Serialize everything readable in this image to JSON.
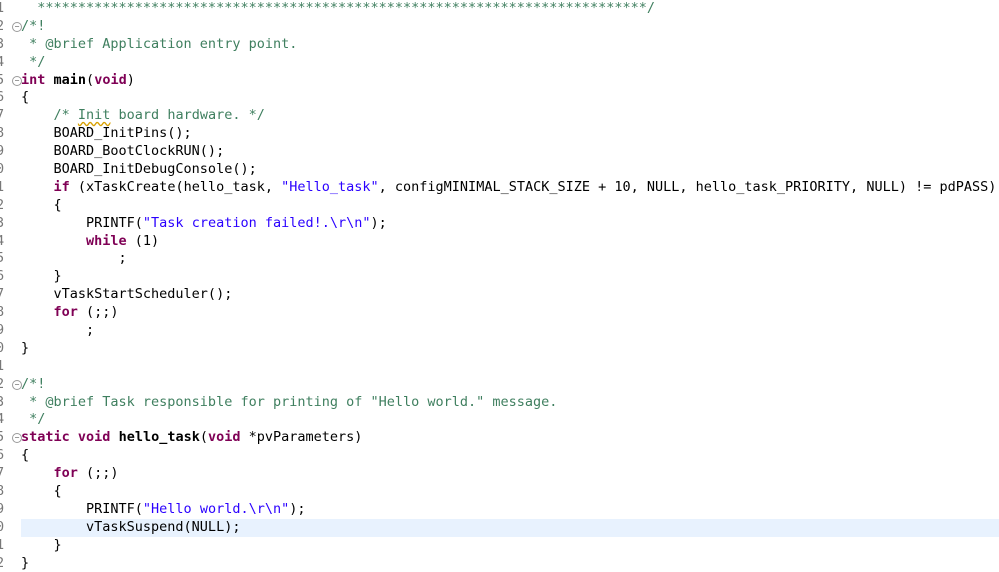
{
  "editor": {
    "lines": [
      {
        "num": "1",
        "fold": false,
        "tokens": [
          {
            "t": "comment",
            "v": "  ***************************************************************************/"
          }
        ]
      },
      {
        "num": "2",
        "fold": true,
        "tokens": [
          {
            "t": "comment",
            "v": "/*!"
          }
        ]
      },
      {
        "num": "3",
        "fold": false,
        "tokens": [
          {
            "t": "comment",
            "v": " * @brief Application entry point."
          }
        ]
      },
      {
        "num": "4",
        "fold": false,
        "tokens": [
          {
            "t": "comment",
            "v": " */"
          }
        ]
      },
      {
        "num": "5",
        "fold": true,
        "tokens": [
          {
            "t": "kw",
            "v": "int"
          },
          {
            "t": "id",
            "v": " "
          },
          {
            "t": "fn",
            "v": "main"
          },
          {
            "t": "id",
            "v": "("
          },
          {
            "t": "kw",
            "v": "void"
          },
          {
            "t": "id",
            "v": ")"
          }
        ]
      },
      {
        "num": "6",
        "fold": false,
        "tokens": [
          {
            "t": "id",
            "v": "{"
          }
        ]
      },
      {
        "num": "7",
        "fold": false,
        "tokens": [
          {
            "t": "comment",
            "v": "    /* "
          },
          {
            "t": "comment-spell",
            "v": "Init"
          },
          {
            "t": "comment",
            "v": " board hardware. */"
          }
        ]
      },
      {
        "num": "8",
        "fold": false,
        "tokens": [
          {
            "t": "id",
            "v": "    BOARD_InitPins();"
          }
        ]
      },
      {
        "num": "9",
        "fold": false,
        "tokens": [
          {
            "t": "id",
            "v": "    BOARD_BootClockRUN();"
          }
        ]
      },
      {
        "num": "0",
        "fold": false,
        "tokens": [
          {
            "t": "id",
            "v": "    BOARD_InitDebugConsole();"
          }
        ]
      },
      {
        "num": "1",
        "fold": false,
        "tokens": [
          {
            "t": "id",
            "v": "    "
          },
          {
            "t": "kw",
            "v": "if"
          },
          {
            "t": "id",
            "v": " (xTaskCreate(hello_task, "
          },
          {
            "t": "str",
            "v": "\"Hello_task\""
          },
          {
            "t": "id",
            "v": ", configMINIMAL_STACK_SIZE + 10, NULL, hello_task_PRIORITY, NULL) != pdPASS)"
          }
        ]
      },
      {
        "num": "2",
        "fold": false,
        "tokens": [
          {
            "t": "id",
            "v": "    {"
          }
        ]
      },
      {
        "num": "3",
        "fold": false,
        "tokens": [
          {
            "t": "id",
            "v": "        PRINTF("
          },
          {
            "t": "str",
            "v": "\"Task creation failed!.\\r\\n\""
          },
          {
            "t": "id",
            "v": ");"
          }
        ]
      },
      {
        "num": "4",
        "fold": false,
        "tokens": [
          {
            "t": "id",
            "v": "        "
          },
          {
            "t": "kw",
            "v": "while"
          },
          {
            "t": "id",
            "v": " (1)"
          }
        ]
      },
      {
        "num": "5",
        "fold": false,
        "tokens": [
          {
            "t": "id",
            "v": "            ;"
          }
        ]
      },
      {
        "num": "6",
        "fold": false,
        "tokens": [
          {
            "t": "id",
            "v": "    }"
          }
        ]
      },
      {
        "num": "7",
        "fold": false,
        "tokens": [
          {
            "t": "id",
            "v": "    vTaskStartScheduler();"
          }
        ]
      },
      {
        "num": "8",
        "fold": false,
        "tokens": [
          {
            "t": "id",
            "v": "    "
          },
          {
            "t": "kw",
            "v": "for"
          },
          {
            "t": "id",
            "v": " (;;)"
          }
        ]
      },
      {
        "num": "9",
        "fold": false,
        "tokens": [
          {
            "t": "id",
            "v": "        ;"
          }
        ]
      },
      {
        "num": "0",
        "fold": false,
        "tokens": [
          {
            "t": "id",
            "v": "}"
          }
        ]
      },
      {
        "num": "1",
        "fold": false,
        "tokens": []
      },
      {
        "num": "2",
        "fold": true,
        "tokens": [
          {
            "t": "comment",
            "v": "/*!"
          }
        ]
      },
      {
        "num": "3",
        "fold": false,
        "tokens": [
          {
            "t": "comment",
            "v": " * @brief Task responsible for printing of \"Hello world.\" message."
          }
        ]
      },
      {
        "num": "4",
        "fold": false,
        "tokens": [
          {
            "t": "comment",
            "v": " */"
          }
        ]
      },
      {
        "num": "5",
        "fold": true,
        "tokens": [
          {
            "t": "kw",
            "v": "static"
          },
          {
            "t": "id",
            "v": " "
          },
          {
            "t": "kw",
            "v": "void"
          },
          {
            "t": "id",
            "v": " "
          },
          {
            "t": "fn",
            "v": "hello_task"
          },
          {
            "t": "id",
            "v": "("
          },
          {
            "t": "kw",
            "v": "void"
          },
          {
            "t": "id",
            "v": " *pvParameters)"
          }
        ]
      },
      {
        "num": "6",
        "fold": false,
        "tokens": [
          {
            "t": "id",
            "v": "{"
          }
        ]
      },
      {
        "num": "7",
        "fold": false,
        "tokens": [
          {
            "t": "id",
            "v": "    "
          },
          {
            "t": "kw",
            "v": "for"
          },
          {
            "t": "id",
            "v": " (;;)"
          }
        ]
      },
      {
        "num": "8",
        "fold": false,
        "tokens": [
          {
            "t": "id",
            "v": "    {"
          }
        ]
      },
      {
        "num": "9",
        "fold": false,
        "tokens": [
          {
            "t": "id",
            "v": "        PRINTF("
          },
          {
            "t": "str",
            "v": "\"Hello world.\\r\\n\""
          },
          {
            "t": "id",
            "v": ");"
          }
        ]
      },
      {
        "num": "0",
        "fold": false,
        "current": true,
        "tokens": [
          {
            "t": "id",
            "v": "        vTaskSuspend(NULL);"
          }
        ]
      },
      {
        "num": "1",
        "fold": false,
        "tokens": [
          {
            "t": "id",
            "v": "    }"
          }
        ]
      },
      {
        "num": "2",
        "fold": false,
        "tokens": [
          {
            "t": "id",
            "v": "}"
          }
        ]
      }
    ]
  },
  "colors": {
    "comment": "#3f7f5f",
    "keyword": "#7f0055",
    "string": "#2a00ff",
    "current_line": "#e8f2fe"
  },
  "icons": {
    "fold": "fold-collapse-icon"
  }
}
